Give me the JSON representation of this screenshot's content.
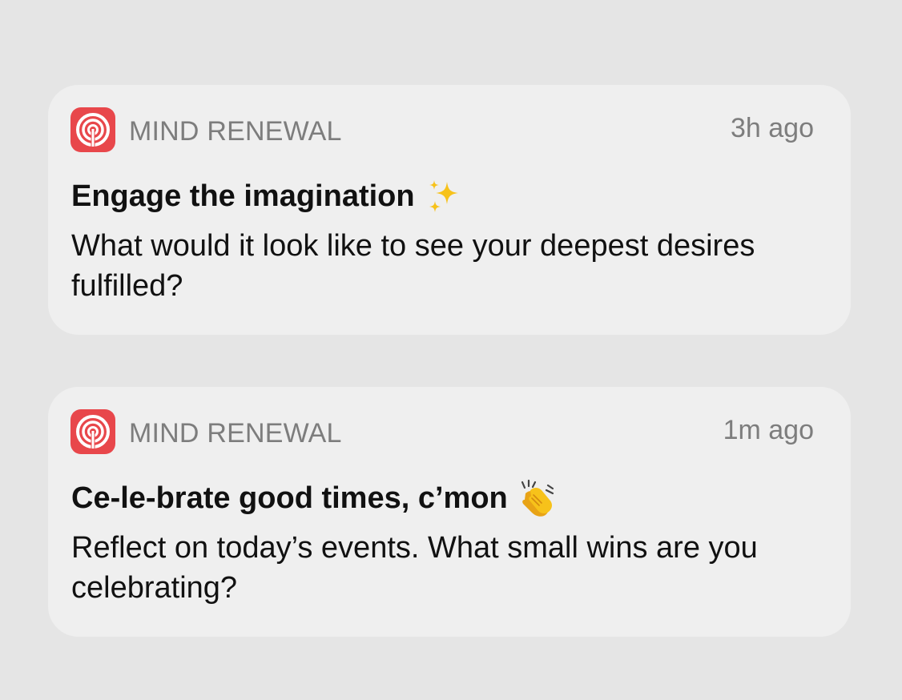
{
  "notifications": [
    {
      "app_name": "MIND RENEWAL",
      "timestamp": "3h ago",
      "title": "Engage the imagination",
      "emoji": "sparkles-emoji",
      "body": "What would it look like to see your deepest desires fulfilled?"
    },
    {
      "app_name": "MIND RENEWAL",
      "timestamp": "1m ago",
      "title": "Ce-le-brate good times, c’mon",
      "emoji": "clapping-hands-emoji",
      "body": "Reflect on today’s events. What small wins are you celebrating?"
    }
  ],
  "colors": {
    "background": "#e5e5e5",
    "card": "#efefef",
    "app_icon": "#e8474b",
    "secondary_text": "#7d7d7d",
    "primary_text": "#111111"
  }
}
